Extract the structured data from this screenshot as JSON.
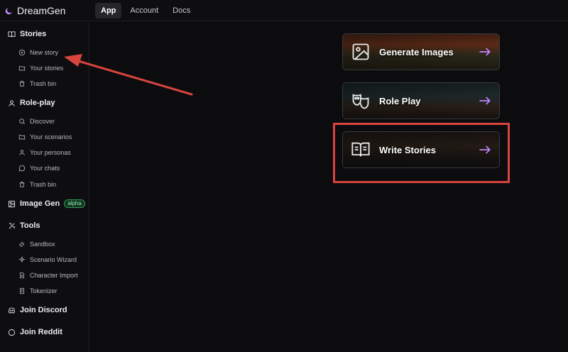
{
  "brand": {
    "name": "DreamGen"
  },
  "nav": {
    "tabs": [
      "App",
      "Account",
      "Docs"
    ],
    "active": "App"
  },
  "sidebar": {
    "stories": {
      "title": "Stories",
      "items": [
        "New story",
        "Your stories",
        "Trash bin"
      ]
    },
    "roleplay": {
      "title": "Role-play",
      "items": [
        "Discover",
        "Your scenarios",
        "Your personas",
        "Your chats",
        "Trash bin"
      ]
    },
    "imagegen": {
      "title": "Image Gen",
      "badge": "alpha"
    },
    "tools": {
      "title": "Tools",
      "items": [
        "Sandbox",
        "Scenario Wizard",
        "Character Import",
        "Tokenizer"
      ]
    },
    "discord": {
      "title": "Join Discord"
    },
    "reddit": {
      "title": "Join Reddit"
    }
  },
  "cards": [
    {
      "label": "Generate Images",
      "icon": "image-icon"
    },
    {
      "label": "Role Play",
      "icon": "masks-icon"
    },
    {
      "label": "Write Stories",
      "icon": "book-icon"
    }
  ],
  "colors": {
    "accent": "#c084fc",
    "annotation": "#d9443f",
    "badge": "#22c55e"
  }
}
